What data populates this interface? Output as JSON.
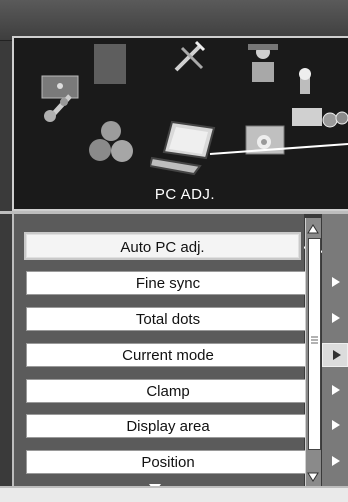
{
  "menu": {
    "title": "PC ADJ."
  },
  "items": [
    "Auto PC adj.",
    "Fine sync",
    "Total dots",
    "Current mode",
    "Clamp",
    "Display area",
    "Position"
  ],
  "colors": {
    "panel_dark": "#1a1a1a",
    "list_bg": "#5b5b5b",
    "item_bg": "#ffffff"
  },
  "icons": [
    "picture-settings-icon",
    "gray-square-icon",
    "tools-icon",
    "person-icon",
    "color-balls-icon",
    "laptop-pc-icon",
    "screen-icon",
    "mirror-sound-icon"
  ]
}
